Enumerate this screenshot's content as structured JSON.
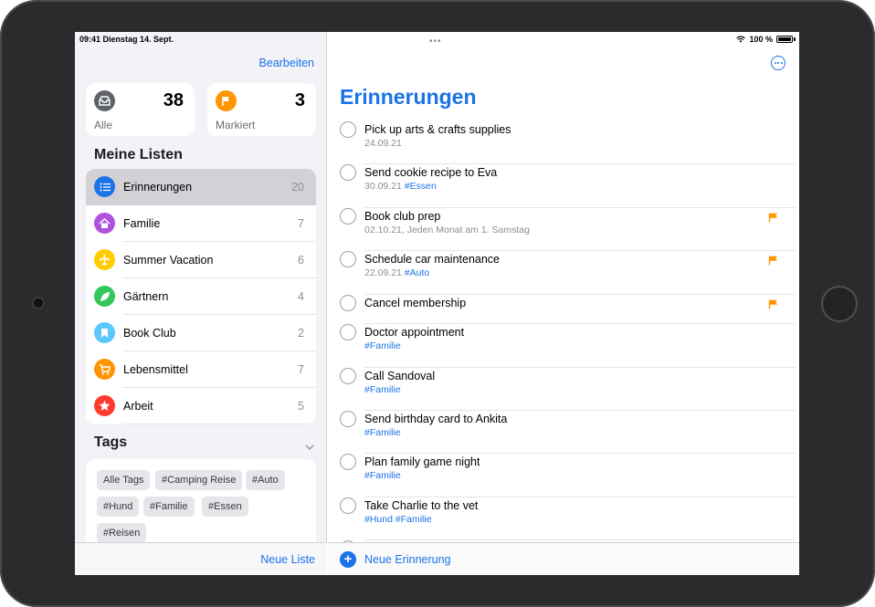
{
  "status": {
    "time_date": "09:41  Dienstag 14. Sept.",
    "battery": "100 %"
  },
  "sidebar": {
    "edit_label": "Bearbeiten",
    "smart_lists": [
      {
        "label": "Alle",
        "count": "38",
        "color": "#5f6368",
        "icon": "tray-icon"
      },
      {
        "label": "Markiert",
        "count": "3",
        "color": "#ff9500",
        "icon": "flag-icon"
      }
    ],
    "my_lists_title": "Meine Listen",
    "lists": [
      {
        "name": "Erinnerungen",
        "count": "20",
        "color": "#1a73e8",
        "icon": "list-icon",
        "selected": true
      },
      {
        "name": "Familie",
        "count": "7",
        "color": "#af52de",
        "icon": "house-icon"
      },
      {
        "name": "Summer Vacation",
        "count": "6",
        "color": "#ffcc00",
        "icon": "airplane-icon"
      },
      {
        "name": "Gärtnern",
        "count": "4",
        "color": "#34c759",
        "icon": "leaf-icon"
      },
      {
        "name": "Book Club",
        "count": "2",
        "color": "#5ac8fa",
        "icon": "bookmark-icon"
      },
      {
        "name": "Lebensmittel",
        "count": "7",
        "color": "#ff9500",
        "icon": "cart-icon"
      },
      {
        "name": "Arbeit",
        "count": "5",
        "color": "#ff3b30",
        "icon": "star-icon"
      }
    ],
    "tags_title": "Tags",
    "tags": [
      "Alle Tags",
      "#Camping Reise",
      "#Auto",
      "#Hund",
      "#Familie",
      "#Essen",
      "#Reisen"
    ],
    "new_list_label": "Neue Liste"
  },
  "main": {
    "title": "Erinnerungen",
    "tasks": [
      {
        "name": "Pick up arts & crafts supplies",
        "meta": "24.09.21",
        "tags": "",
        "flagged": false
      },
      {
        "name": "Send cookie recipe to Eva",
        "meta": "30.09.21",
        "tags": "#Essen",
        "flagged": false
      },
      {
        "name": "Book club prep",
        "meta": "02.10.21, Jeden Monat am 1. Samstag",
        "tags": "",
        "flagged": true
      },
      {
        "name": "Schedule car maintenance",
        "meta": "22.09.21",
        "tags": "#Auto",
        "flagged": true
      },
      {
        "name": "Cancel membership",
        "meta": "",
        "tags": "",
        "flagged": true
      },
      {
        "name": "Doctor appointment",
        "meta": "",
        "tags": "#Familie",
        "flagged": false
      },
      {
        "name": "Call Sandoval",
        "meta": "",
        "tags": "#Familie",
        "flagged": false
      },
      {
        "name": "Send birthday card to Ankita",
        "meta": "",
        "tags": "#Familie",
        "flagged": false
      },
      {
        "name": "Plan family game night",
        "meta": "",
        "tags": "#Familie",
        "flagged": false
      },
      {
        "name": "Take Charlie to the vet",
        "meta": "",
        "tags": "#Hund #Familie",
        "flagged": false
      }
    ],
    "new_reminder_label": "Neue Erinnerung",
    "accent": "#1a73e8",
    "flag_color": "#ff9500"
  }
}
